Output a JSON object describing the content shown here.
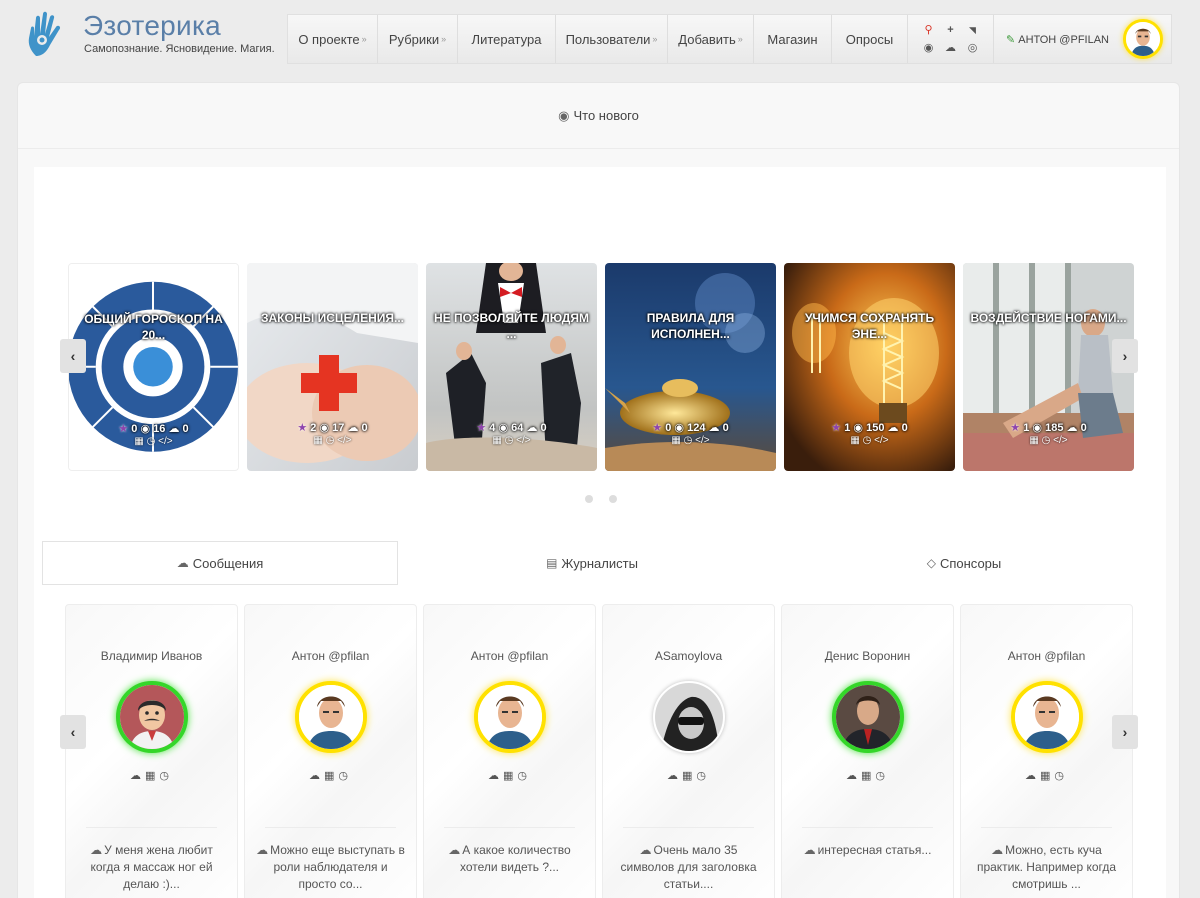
{
  "header": {
    "brand_title": "Эзотерика",
    "brand_subtitle": "Самопознание. Ясновидение. Магия.",
    "nav": [
      {
        "label": "О проекте",
        "dropdown": true
      },
      {
        "label": "Рубрики",
        "dropdown": true
      },
      {
        "label": "Литература",
        "dropdown": false
      },
      {
        "label": "Пользователи",
        "dropdown": true
      },
      {
        "label": "Добавить",
        "dropdown": true
      },
      {
        "label": "Магазин",
        "dropdown": false
      },
      {
        "label": "Опросы",
        "dropdown": false
      }
    ],
    "icons": [
      "search-icon",
      "plus-icon",
      "rss-icon",
      "record-icon",
      "comments-icon",
      "eye-icon"
    ],
    "user_label": "АНТОН @PFILAN"
  },
  "whatsnew_label": "Что нового",
  "articles": [
    {
      "title": "ОБЩИЙ ГОРОСКОП НА 20...",
      "stars": "0",
      "views": "16",
      "comments": "0"
    },
    {
      "title": "ЗАКОНЫ ИСЦЕЛЕНИЯ...",
      "stars": "2",
      "views": "17",
      "comments": "0"
    },
    {
      "title": "НЕ ПОЗВОЛЯЙТЕ ЛЮДЯМ ...",
      "stars": "4",
      "views": "64",
      "comments": "0"
    },
    {
      "title": "ПРАВИЛА ДЛЯ ИСПОЛНЕН...",
      "stars": "0",
      "views": "124",
      "comments": "0"
    },
    {
      "title": "УЧИМСЯ СОХРАНЯТЬ ЭНЕ...",
      "stars": "1",
      "views": "150",
      "comments": "0"
    },
    {
      "title": "ВОЗДЕЙСТВИЕ НОГАМИ...",
      "stars": "1",
      "views": "185",
      "comments": "0"
    }
  ],
  "tabs": [
    {
      "label": "Сообщения",
      "active": true
    },
    {
      "label": "Журналисты",
      "active": false
    },
    {
      "label": "Спонсоры",
      "active": false
    }
  ],
  "comments": [
    {
      "user": "Владимир Иванов",
      "text": "У меня жена любит когда я массаж ног ей делаю :)...",
      "ring": "green"
    },
    {
      "user": "Антон @pfilan",
      "text": "Можно еще выступать в роли наблюдателя и просто со...",
      "ring": "yellow"
    },
    {
      "user": "Антон @pfilan",
      "text": "А какое количество хотели видеть ?...",
      "ring": "yellow"
    },
    {
      "user": "ASamoylova",
      "text": "Очень мало 35 символов для заголовка статьи....",
      "ring": "plain"
    },
    {
      "user": "Денис Воронин",
      "text": "интересная статья...",
      "ring": "green"
    },
    {
      "user": "Антон @pfilan",
      "text": "Можно, есть куча практик. Например когда смотришь ...",
      "ring": "yellow"
    }
  ],
  "colors": {
    "accent": "#5a7fa8",
    "online_ring": "#34d629",
    "vip_ring": "#ffe100",
    "search_icon": "#d9372a"
  }
}
